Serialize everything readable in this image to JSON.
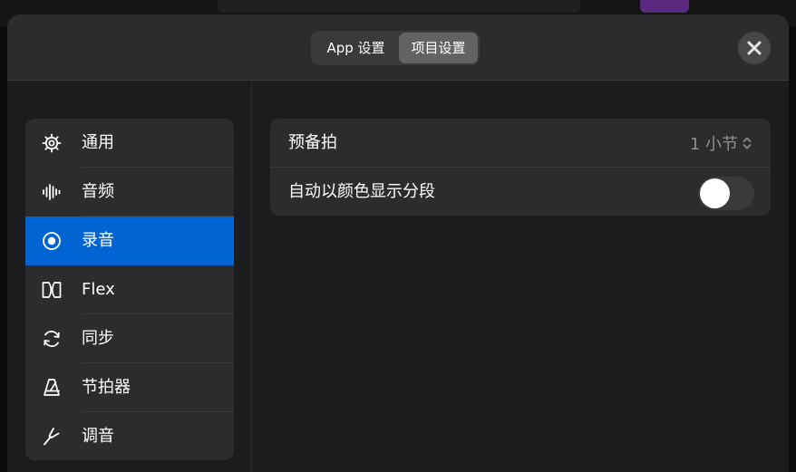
{
  "header": {
    "tabs": [
      {
        "label": "App 设置",
        "selected": false
      },
      {
        "label": "项目设置",
        "selected": true
      }
    ],
    "close_icon": "close-icon"
  },
  "sidebar": {
    "items": [
      {
        "label": "通用",
        "icon": "gear-icon",
        "selected": false
      },
      {
        "label": "音频",
        "icon": "waveform-icon",
        "selected": false
      },
      {
        "label": "录音",
        "icon": "record-icon",
        "selected": true
      },
      {
        "label": "Flex",
        "icon": "flex-icon",
        "selected": false
      },
      {
        "label": "同步",
        "icon": "sync-icon",
        "selected": false
      },
      {
        "label": "节拍器",
        "icon": "metronome-icon",
        "selected": false
      },
      {
        "label": "调音",
        "icon": "tuning-fork-icon",
        "selected": false
      }
    ]
  },
  "settings": {
    "count_in": {
      "label": "预备拍",
      "value": "1 小节"
    },
    "auto_color": {
      "label": "自动以颜色显示分段",
      "on": false
    }
  },
  "colors": {
    "accent_selected": "#0064d2",
    "panel": "#2c2c2e",
    "background": "#1c1c1e"
  }
}
